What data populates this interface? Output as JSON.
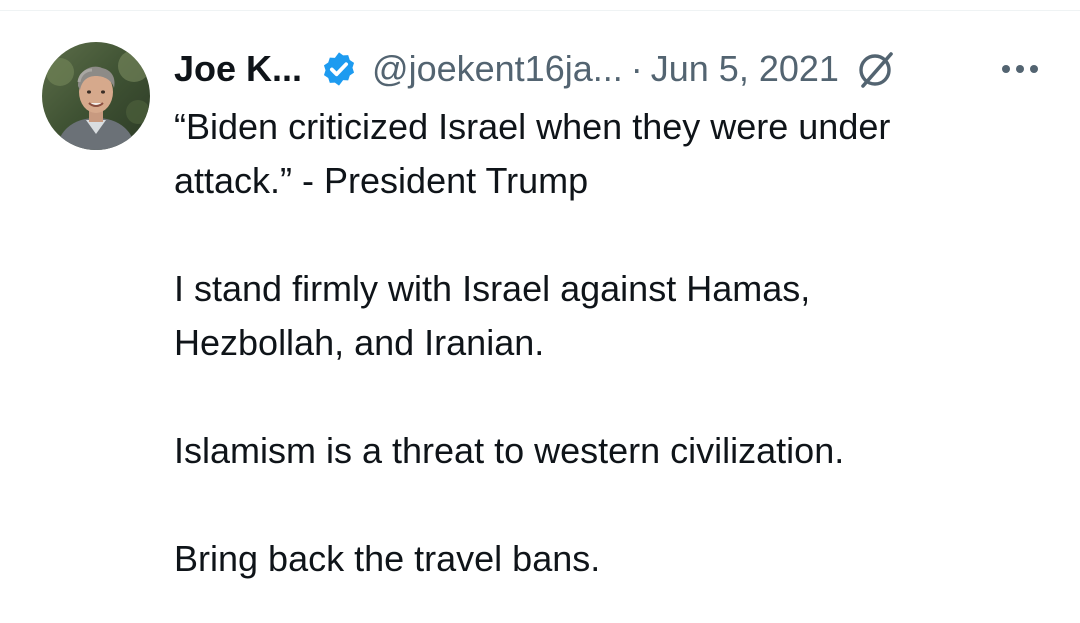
{
  "tweet": {
    "author": {
      "display_name": "Joe K...",
      "handle": "@joekent16ja...",
      "verified": true
    },
    "separator": "·",
    "date": "Jun 5, 2021",
    "icons": {
      "verified": "verified-badge-icon",
      "grok": "grok-icon",
      "more": "more-options-icon"
    },
    "colors": {
      "verified_blue": "#1d9bf0",
      "meta_gray": "#536471",
      "text": "#0f1419"
    },
    "paragraphs": [
      {
        "lines": [
          "“Biden criticized Israel when they were under",
          "attack.” - President Trump"
        ]
      },
      {
        "lines": [
          "I stand firmly with Israel against Hamas,",
          "Hezbollah, and Iranian."
        ]
      },
      {
        "lines": [
          "Islamism is a threat to western civilization."
        ]
      },
      {
        "lines": [
          "Bring back the travel bans."
        ]
      }
    ]
  }
}
